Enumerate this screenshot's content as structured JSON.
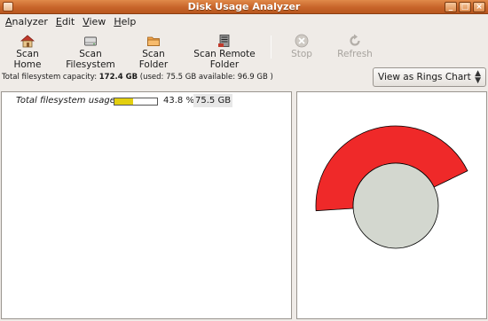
{
  "window": {
    "title": "Disk Usage Analyzer",
    "buttons": [
      "_",
      "□",
      "×"
    ]
  },
  "menu": [
    {
      "label": "Analyzer",
      "mnemonic": "A"
    },
    {
      "label": "Edit",
      "mnemonic": "E"
    },
    {
      "label": "View",
      "mnemonic": "V"
    },
    {
      "label": "Help",
      "mnemonic": "H"
    }
  ],
  "toolbar": {
    "scan_home": "Scan Home",
    "scan_filesystem": "Scan Filesystem",
    "scan_folder": "Scan Folder",
    "scan_remote_folder": "Scan Remote Folder",
    "stop": "Stop",
    "refresh": "Refresh"
  },
  "capacity": {
    "prefix": "Total filesystem capacity: ",
    "total": "172.4 GB",
    "detail": " (used: 75.5 GB available: 96.9 GB )"
  },
  "view_select": {
    "selected": "View as Rings Chart",
    "arrow": "▲▼"
  },
  "usage": {
    "label": "Total filesystem usage:",
    "fraction": 0.438,
    "percent_text": "43.8 %",
    "size_text": "75.5 GB",
    "bar_color": "#e3cf0f"
  },
  "rings_chart": {
    "center_color": "#d3d7cf",
    "ring_color": "#ef2929",
    "used_fraction": 0.438
  }
}
